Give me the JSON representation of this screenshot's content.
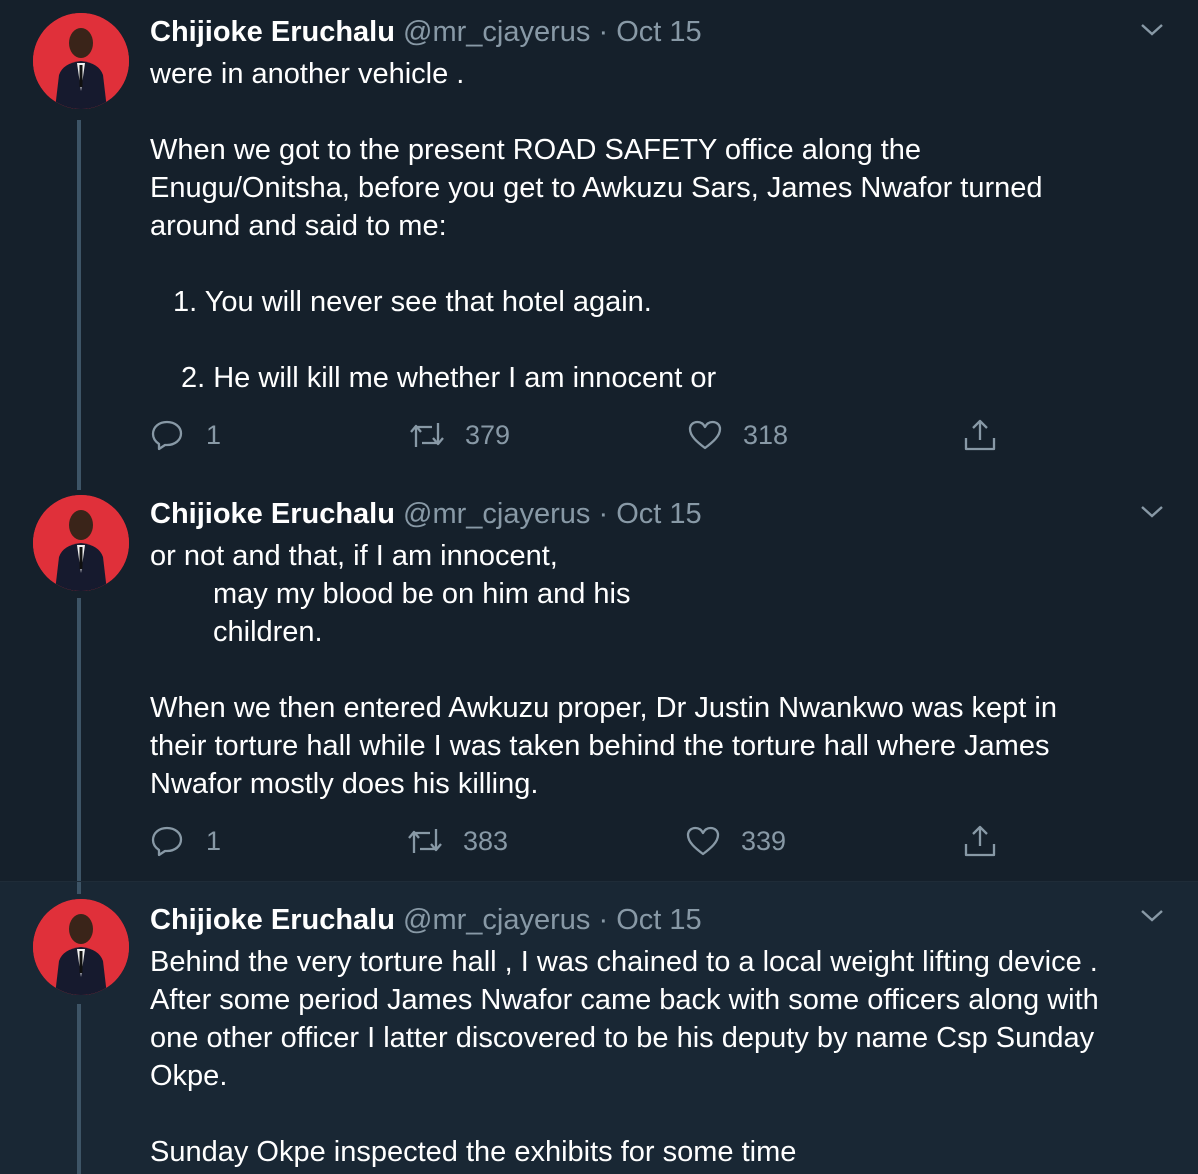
{
  "tweets": [
    {
      "author": "Chijioke Eruchalu",
      "handle": "@mr_cjayerus",
      "separator": "·",
      "date": "Oct 15",
      "lines": [
        "were in another vehicle .",
        "",
        "When we got to the present ROAD SAFETY office along the",
        "Enugu/Onitsha, before you get to Awkuzu Sars,  James Nwafor turned",
        "around and said to me:",
        "",
        "   1. You will never see that hotel again.",
        "",
        "    2. He will kill me whether I am innocent or"
      ],
      "replies": "1",
      "retweets": "379",
      "likes": "318"
    },
    {
      "author": "Chijioke Eruchalu",
      "handle": "@mr_cjayerus",
      "separator": "·",
      "date": "Oct 15",
      "lines": [
        "or not and that, if I am innocent,",
        "         may my blood be on him and his",
        "         children.",
        "",
        "When we then entered Awkuzu proper, Dr Justin Nwankwo was kept in",
        "their torture hall while I was taken behind the torture hall where James",
        "Nwafor mostly does his killing."
      ],
      "replies": "1",
      "retweets": "383",
      "likes": "339"
    },
    {
      "author": "Chijioke Eruchalu",
      "handle": "@mr_cjayerus",
      "separator": "·",
      "date": "Oct 15",
      "lines": [
        "Behind the very torture hall , I was chained to a local weight lifting device .",
        "After some period James Nwafor came back with some officers along with",
        "one other officer I latter discovered to be his deputy by name Csp Sunday",
        "Okpe.",
        "",
        "Sunday Okpe inspected the exhibits for some time"
      ]
    }
  ],
  "icons": {
    "reply": "reply-icon",
    "retweet": "retweet-icon",
    "like": "heart-icon",
    "share": "share-icon",
    "more": "chevron-down-icon"
  },
  "colors": {
    "background": "#15202b",
    "focused_background": "#192734",
    "text": "#ffffff",
    "secondary_text": "#8899a6",
    "thread_line": "#3d5466",
    "avatar_background": "#e0303a"
  }
}
